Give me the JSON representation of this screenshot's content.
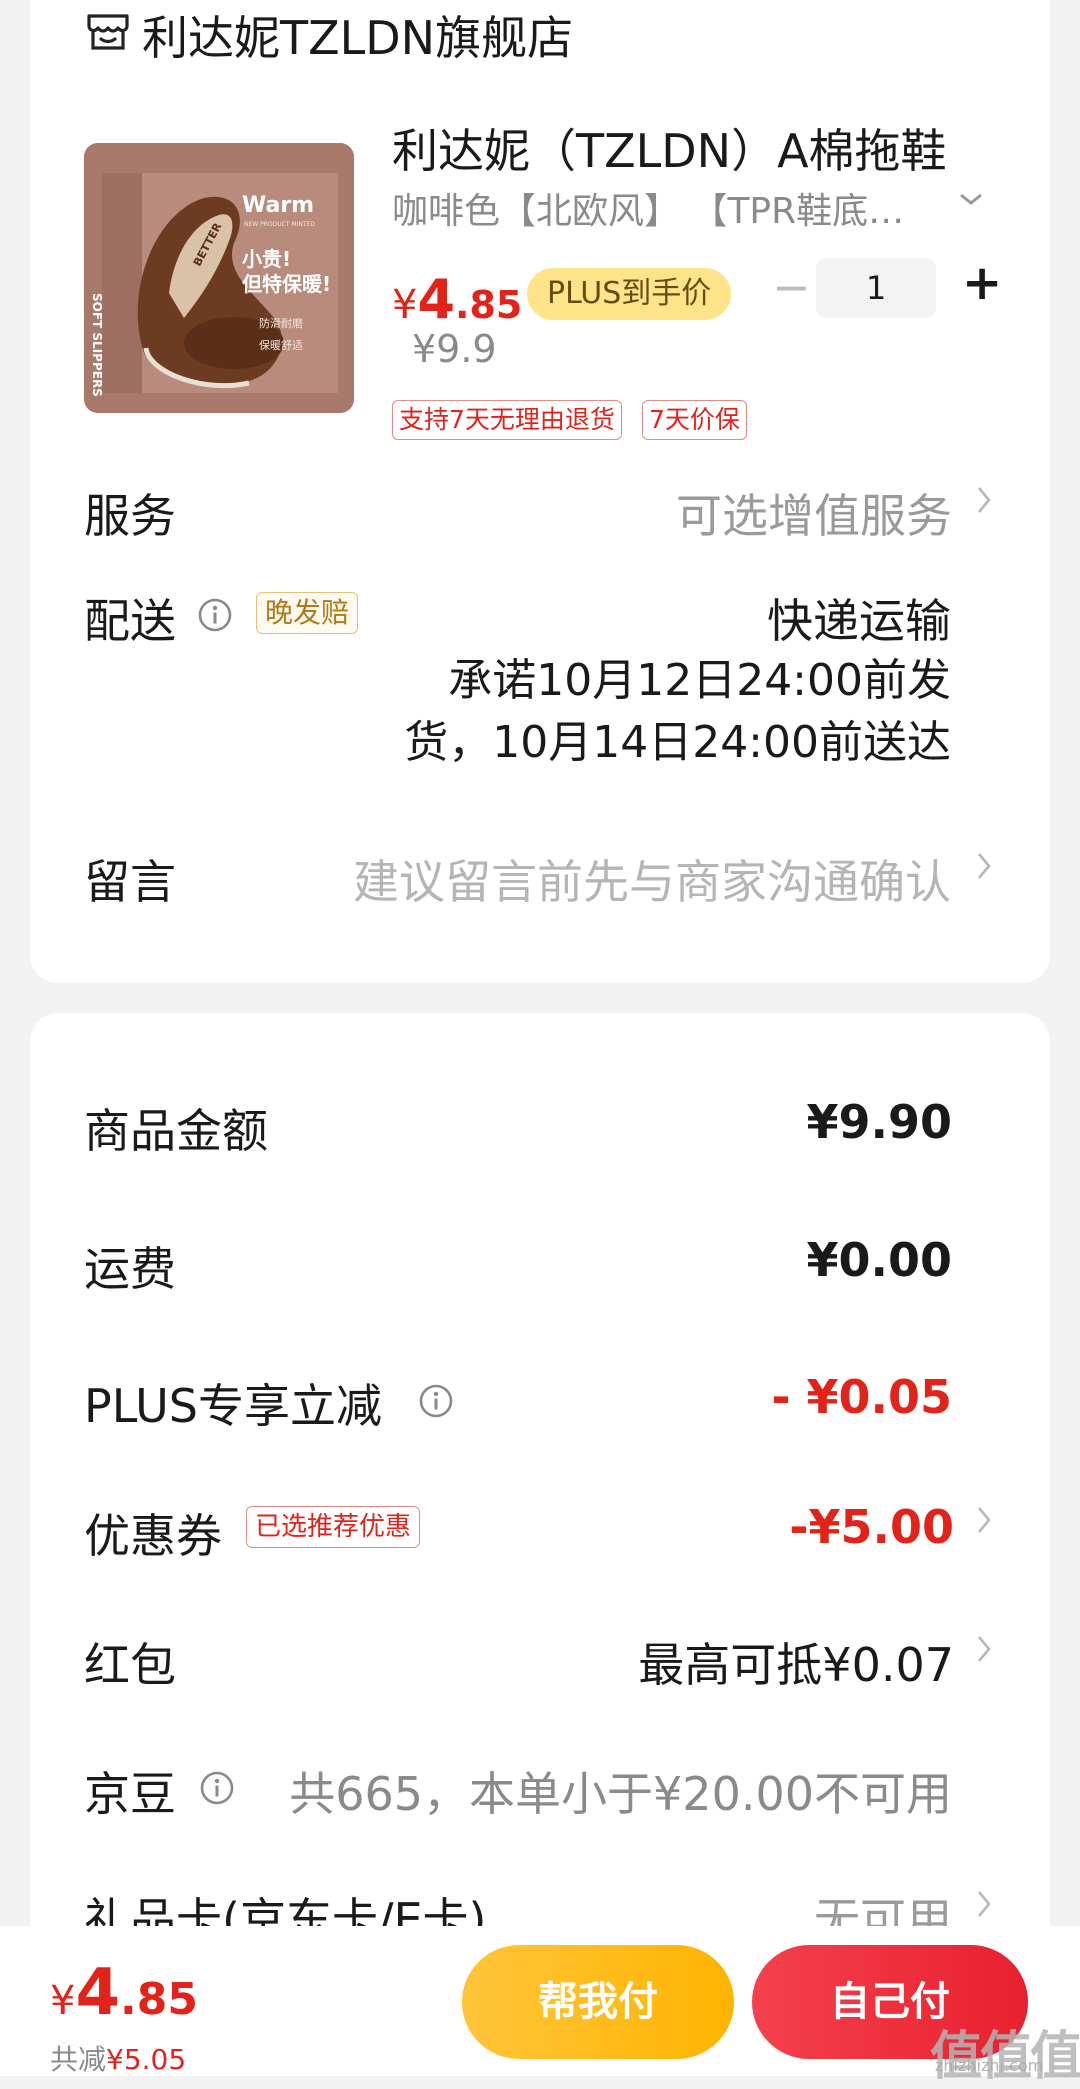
{
  "shop": {
    "icon": "store-icon",
    "name": "利达妮TZLDN旗舰店"
  },
  "product": {
    "image_text": {
      "warm": "Warm",
      "sub": "NEW PRODUCT MINTED",
      "headline_1": "小贵!",
      "headline_2": "但特保暖!",
      "feature_1": "防滑耐磨",
      "feature_2": "保暖舒适",
      "side": "SOFT SLIPPERS",
      "brand": "BETTER"
    },
    "title": "利达妮（TZLDN）A棉拖鞋",
    "spec": "咖啡色【北欧风】 【TPR鞋底加厚】",
    "price_currency": "¥",
    "price_int": "4",
    "price_dec": ".85",
    "plus_badge": "PLUS到手价",
    "quantity_minus": "−",
    "quantity": "1",
    "quantity_plus": "+",
    "original_price": "¥9.9",
    "tags": [
      "支持7天无理由退货",
      "7天价保"
    ]
  },
  "service": {
    "label": "服务",
    "value": "可选增值服务"
  },
  "delivery": {
    "label": "配送",
    "late_badge": "晚发赔",
    "method": "快递运输",
    "promise": "承诺10月12日24:00前发货，10月14日24:00前送达"
  },
  "message": {
    "label": "留言",
    "placeholder": "建议留言前先与商家沟通确认"
  },
  "fees": {
    "goods_label": "商品金额",
    "goods_value": "¥9.90",
    "shipping_label": "运费",
    "shipping_value": "¥0.00",
    "plus_label": "PLUS专享立减",
    "plus_value": "- ¥0.05",
    "coupon_label": "优惠券",
    "coupon_badge": "已选推荐优惠",
    "coupon_value": "-¥5.00",
    "redpacket_label": "红包",
    "redpacket_value": "最高可抵¥0.07",
    "bean_label": "京豆",
    "bean_value": "共665，本单小于¥20.00不可用",
    "giftcard_label": "礼品卡(京东卡/E卡)",
    "giftcard_value": "无可用"
  },
  "bottom": {
    "total_currency": "¥",
    "total_int": "4",
    "total_dec": ".85",
    "saved_prefix": "共减",
    "saved_value": "¥5.05",
    "help_pay": "帮我付",
    "self_pay": "自己付"
  },
  "watermark": {
    "main": "值值值",
    "sub": "zhizhizhi.com"
  },
  "colors": {
    "accent_red": "#e2231a",
    "plus_yellow": "#ffe48a",
    "help_pay": "#ffb400",
    "self_pay": "#e8202e"
  }
}
